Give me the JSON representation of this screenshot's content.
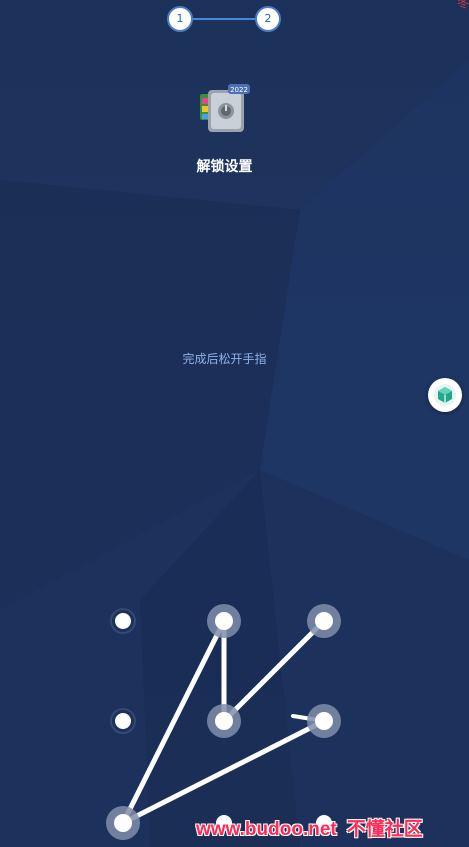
{
  "stepper": {
    "steps": [
      "1",
      "2"
    ],
    "active_step": 2
  },
  "app": {
    "icon": "vault-safe-icon",
    "badge": "2022",
    "title": "解锁设置"
  },
  "hint": {
    "text": "完成后松开手指"
  },
  "floating_button": {
    "icon": "green-cube-icon"
  },
  "top_right": {
    "glyph": "冬"
  },
  "pattern": {
    "dots": [
      {
        "id": 1,
        "selected": false
      },
      {
        "id": 2,
        "selected": true
      },
      {
        "id": 3,
        "selected": true
      },
      {
        "id": 4,
        "selected": false
      },
      {
        "id": 5,
        "selected": true
      },
      {
        "id": 6,
        "selected": true
      },
      {
        "id": 7,
        "selected": true
      },
      {
        "id": 8,
        "selected": false
      },
      {
        "id": 9,
        "selected": false
      }
    ],
    "sequence": [
      7,
      2,
      5,
      3
    ],
    "partial_from": 7,
    "partial_to": 6
  },
  "watermark": {
    "url": "www.budoo.net",
    "cn": "不懂社区"
  },
  "colors": {
    "background": "#1d3360",
    "accent": "#4a86d8",
    "hint": "#8fb2e8",
    "watermark": "#ff2a55"
  }
}
